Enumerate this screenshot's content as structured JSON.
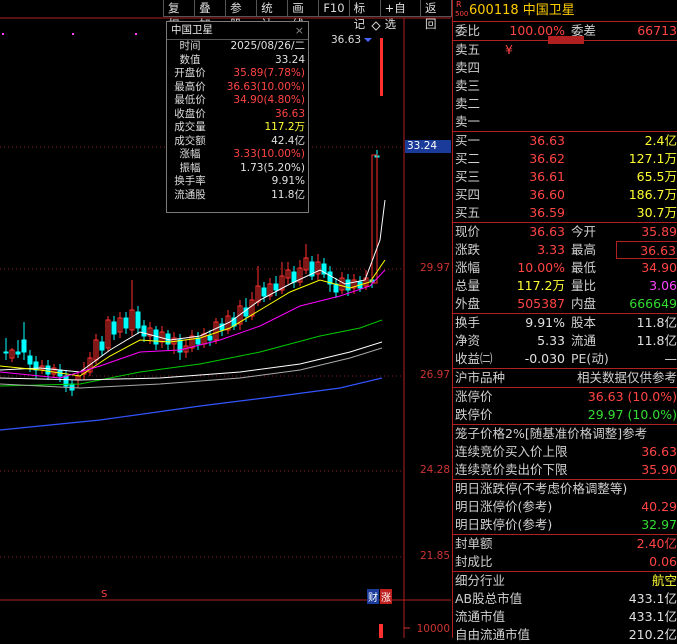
{
  "toolbar": {
    "items": [
      "复权",
      "叠加",
      "参股",
      "统计",
      "画线",
      "F10",
      "标记",
      "+自选",
      "返回"
    ]
  },
  "chart": {
    "price_levels": [
      "33.24",
      "29.97",
      "26.97",
      "24.28",
      "21.85"
    ],
    "current_price": "33.24",
    "high_marker": "36.63",
    "volume_label": "10000",
    "event_marker_s": "S",
    "event_marker_cai": "财",
    "event_marker_zhang": "涨",
    "colors": {
      "up": "#ff3030",
      "down": "#00ffff",
      "ma5": "#ffffff",
      "ma10": "#ffff00",
      "ma20": "#ff00ff",
      "ma30": "#00cc00",
      "ma60": "#ffffff",
      "ma120": "#3355ff"
    }
  },
  "info_box": {
    "title": "中国卫星",
    "close_icon": "×",
    "rows": [
      {
        "k": "时间",
        "v": "2025/08/26/二",
        "c": "white"
      },
      {
        "k": "数值",
        "v": "33.24",
        "c": "white"
      },
      {
        "k": "开盘价",
        "v": "35.89(7.78%)",
        "c": "red"
      },
      {
        "k": "最高价",
        "v": "36.63(10.00%)",
        "c": "red"
      },
      {
        "k": "最低价",
        "v": "34.90(4.80%)",
        "c": "red"
      },
      {
        "k": "收盘价",
        "v": "36.63",
        "c": "red"
      },
      {
        "k": "成交量",
        "v": "117.2万",
        "c": "yellow"
      },
      {
        "k": "成交额",
        "v": "42.4亿",
        "c": "white"
      },
      {
        "k": "涨幅",
        "v": "3.33(10.00%)",
        "c": "red"
      },
      {
        "k": "振幅",
        "v": "1.73(5.20%)",
        "c": "white"
      },
      {
        "k": "换手率",
        "v": "9.91%",
        "c": "white"
      },
      {
        "k": "流通股",
        "v": "11.8亿",
        "c": "white"
      }
    ]
  },
  "panel": {
    "r_mark": "R",
    "code_sub": "500",
    "code": "600118",
    "name": "中国卫星",
    "weibi_label": "委比",
    "weibi_value": "100.00%",
    "weicha_label": "委差",
    "weicha_value": "66713",
    "sell": [
      {
        "label": "卖五",
        "extra": "¥"
      },
      {
        "label": "卖四"
      },
      {
        "label": "卖三"
      },
      {
        "label": "卖二"
      },
      {
        "label": "卖一"
      }
    ],
    "buy": [
      {
        "label": "买一",
        "price": "36.63",
        "vol": "2.4亿"
      },
      {
        "label": "买二",
        "price": "36.62",
        "vol": "127.1万"
      },
      {
        "label": "买三",
        "price": "36.61",
        "vol": "65.5万"
      },
      {
        "label": "买四",
        "price": "36.60",
        "vol": "186.7万"
      },
      {
        "label": "买五",
        "price": "36.59",
        "vol": "30.7万"
      }
    ],
    "quote": [
      {
        "l1": "现价",
        "v1": "36.63",
        "c1": "red",
        "l2": "今开",
        "v2": "35.89",
        "c2": "red"
      },
      {
        "l1": "涨跌",
        "v1": "3.33",
        "c1": "red",
        "l2": "最高",
        "v2": "36.63",
        "c2": "red",
        "boxed2": true
      },
      {
        "l1": "涨幅",
        "v1": "10.00%",
        "c1": "red",
        "l2": "最低",
        "v2": "34.90",
        "c2": "red"
      },
      {
        "l1": "总量",
        "v1": "117.2万",
        "c1": "yellow",
        "l2": "量比",
        "v2": "3.06",
        "c2": "magenta"
      },
      {
        "l1": "外盘",
        "v1": "505387",
        "c1": "red",
        "l2": "内盘",
        "v2": "666649",
        "c2": "green"
      }
    ],
    "fin": [
      {
        "l1": "换手",
        "v1": "9.91%",
        "l2": "股本",
        "v2": "11.8亿"
      },
      {
        "l1": "净资",
        "v1": "5.33",
        "l2": "流通",
        "v2": "11.8亿"
      },
      {
        "l1": "收益㈡",
        "v1": "-0.030",
        "l2": "PE(动)",
        "v2": "—"
      }
    ],
    "market_left": "沪市品种",
    "market_right": "相关数据仅供参考",
    "limit_up_label": "涨停价",
    "limit_up_value": "36.63 (10.0%)",
    "limit_down_label": "跌停价",
    "limit_down_value": "29.97 (10.0%)",
    "cage_title": "笼子价格2%[随基准价格调整]参考",
    "cage_buy_label": "连续竞价买入价上限",
    "cage_buy_value": "36.63",
    "cage_sell_label": "连续竞价卖出价下限",
    "cage_sell_value": "35.90",
    "tomorrow_title": "明日涨跌停(不考虑价格调整等)",
    "tomorrow_up_label": "明日涨停价(参考)",
    "tomorrow_up_value": "40.29",
    "tomorrow_down_label": "明日跌停价(参考)",
    "tomorrow_down_value": "32.97",
    "seal_amount_label": "封单额",
    "seal_amount_value": "2.40亿",
    "seal_ratio_label": "封成比",
    "seal_ratio_value": "0.06",
    "industry_label": "细分行业",
    "industry_value": "航空",
    "ab_cap_label": "AB股总市值",
    "ab_cap_value": "433.1亿",
    "float_cap_label": "流通市值",
    "float_cap_value": "433.1亿",
    "free_cap_label": "自由流通市值",
    "free_cap_value": "210.2亿"
  }
}
